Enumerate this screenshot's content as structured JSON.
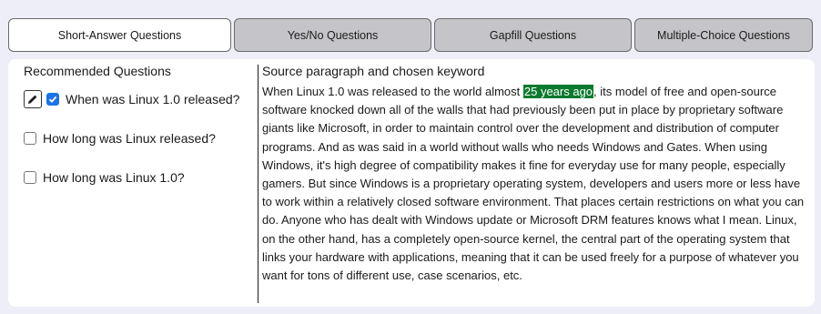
{
  "tabs": [
    {
      "label": "Short-Answer Questions",
      "active": true
    },
    {
      "label": "Yes/No Questions",
      "active": false
    },
    {
      "label": "Gapfill Questions",
      "active": false
    },
    {
      "label": "Multiple-Choice Questions",
      "active": false
    }
  ],
  "left": {
    "heading": "Recommended Questions",
    "questions": [
      {
        "text": "When was Linux 1.0 released?",
        "checked": true,
        "editable": true
      },
      {
        "text": "How long was Linux released?",
        "checked": false,
        "editable": false
      },
      {
        "text": "How long was Linux 1.0?",
        "checked": false,
        "editable": false
      }
    ]
  },
  "right": {
    "heading": "Source paragraph and chosen keyword",
    "before": "When Linux 1.0 was released to the world almost ",
    "keyword": "25 years ago",
    "after": ", its model of free and open-source software knocked down all of the walls that had previously been put in place by proprietary software giants like Microsoft, in order to maintain control over the development and distribution of computer programs. And as was said in a world without walls who needs Windows and Gates. When using Windows, it's high degree of compatibility makes it fine for everyday use for many people, especially gamers. But since Windows is a proprietary operating system, developers and users more or less have to work within a relatively closed software environment. That places certain restrictions on what you can do. Anyone who has dealt with Windows update or Microsoft DRM features knows what I mean. Linux, on the other hand, has a completely open-source kernel, the central part of the operating system that links your hardware with applications, meaning that it can be used freely for a purpose of whatever you want for tons of different use, case scenarios, etc.",
    "highlight_color": "#0b7a2e"
  },
  "colors": {
    "background": "#edeef7",
    "tab_inactive": "#c5c5c9",
    "tab_active": "#ffffff",
    "checkbox_checked": "#1a73e8"
  },
  "icons": {
    "edit": "pencil-icon",
    "check": "checkmark-icon"
  }
}
